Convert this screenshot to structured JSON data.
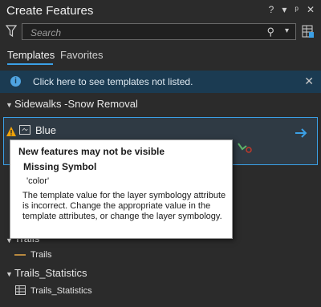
{
  "header": {
    "title": "Create Features",
    "icons": [
      "help-icon",
      "menu-icon",
      "pin-icon",
      "close-icon"
    ],
    "help": "?",
    "menu": "▾",
    "pin": "ᵖ",
    "close": "✕"
  },
  "search": {
    "placeholder": "Search",
    "value": ""
  },
  "tabs": [
    {
      "label": "Templates",
      "selected": true
    },
    {
      "label": "Favorites",
      "selected": false
    }
  ],
  "info_bar": {
    "text": "Click here to see templates not listed.",
    "icon": "i"
  },
  "groups": [
    {
      "name": "Sidewalks -Snow Removal",
      "templates": [
        {
          "label": "Blue",
          "warning": true
        }
      ]
    },
    {
      "name": "Trails",
      "templates": [
        {
          "label": "Trails"
        }
      ]
    },
    {
      "name": "Trails_Statistics",
      "templates": [
        {
          "label": "Trails_Statistics"
        }
      ]
    }
  ],
  "tooltip": {
    "title": "New features may not be visible",
    "subtitle": "Missing Symbol",
    "code": "'color'",
    "body": "The template value for the layer symbology attribute is incorrect.  Change the appropriate value in the template attributes, or change the layer symbology."
  },
  "colors": {
    "accent": "#3ba0e6",
    "warning": "#f0a30a",
    "info_bg": "#1b3b52",
    "trail": "#b8893f"
  }
}
